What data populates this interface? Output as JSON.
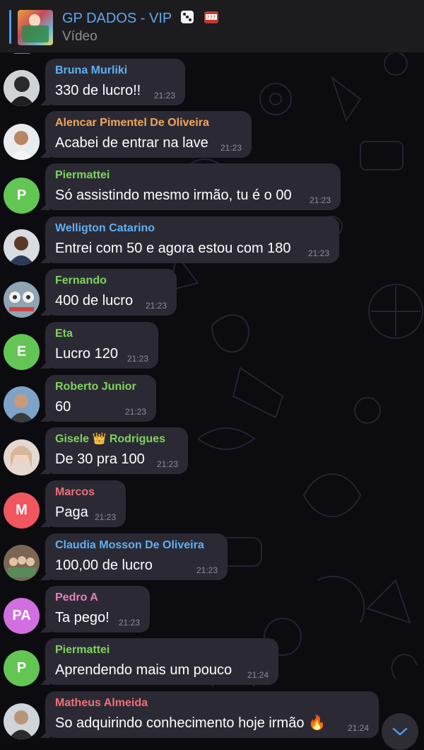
{
  "pinned": {
    "title": "GP DADOS - VIP",
    "subtitle": "Vídeo",
    "title_emojis": [
      "dice-icon",
      "slot-machine-icon"
    ]
  },
  "messages": [
    {
      "sender": "Bruna Murliki",
      "sender_color": "#5fb0f5",
      "text": "330 de lucro!!",
      "time": "21:23",
      "avatar": "photo"
    },
    {
      "sender": "Alencar Pimentel De Oliveira",
      "sender_color": "#f2a65a",
      "text": "Acabei de entrar na lave",
      "time": "21:23",
      "avatar": "photo"
    },
    {
      "sender": "Piermattei",
      "sender_color": "#7fd45c",
      "text": "Só assistindo mesmo irmão, tu é o 00",
      "time": "21:23",
      "avatar": "P",
      "avatar_color": "#63c554"
    },
    {
      "sender": "Welligton Catarino",
      "sender_color": "#5fb0f5",
      "text": "Entrei com 50 e agora estou com 180",
      "time": "21:23",
      "avatar": "photo"
    },
    {
      "sender": "Fernando",
      "sender_color": "#7fd45c",
      "text": "400 de lucro",
      "time": "21:23",
      "avatar": "photo"
    },
    {
      "sender": "Eta",
      "sender_color": "#7fd45c",
      "text": "Lucro 120",
      "time": "21:23",
      "avatar": "E",
      "avatar_color": "#63c554"
    },
    {
      "sender": "Roberto Junior",
      "sender_color": "#7fd45c",
      "text": "60",
      "time": "21:23",
      "avatar": "photo"
    },
    {
      "sender": "Gisele 👑 Rodrigues",
      "sender_color": "#7fd45c",
      "text": "De 30 pra 100",
      "time": "21:23",
      "avatar": "photo"
    },
    {
      "sender": "Marcos",
      "sender_color": "#ef6f79",
      "text": "Paga",
      "time": "21:23",
      "avatar": "M",
      "avatar_color": "#f0565e"
    },
    {
      "sender": "Claudia Mosson De Oliveira",
      "sender_color": "#5fb0f5",
      "text": "100,00 de lucro",
      "time": "21:23",
      "avatar": "photo"
    },
    {
      "sender": "Pedro A",
      "sender_color": "#e77dc1",
      "text": "Ta pego!",
      "time": "21:23",
      "avatar": "PA",
      "avatar_color": "#d16ee0"
    },
    {
      "sender": "Piermattei",
      "sender_color": "#7fd45c",
      "text": "Aprendendo mais um pouco",
      "time": "21:24",
      "avatar": "P",
      "avatar_color": "#63c554"
    },
    {
      "sender": "Matheus Almeida",
      "sender_color": "#ef6f79",
      "text": "So adquirindo conhecimento hoje irmão 🔥",
      "time": "21:24",
      "avatar": "photo"
    }
  ],
  "scroll_button": {
    "icon": "chevron-down-icon"
  }
}
